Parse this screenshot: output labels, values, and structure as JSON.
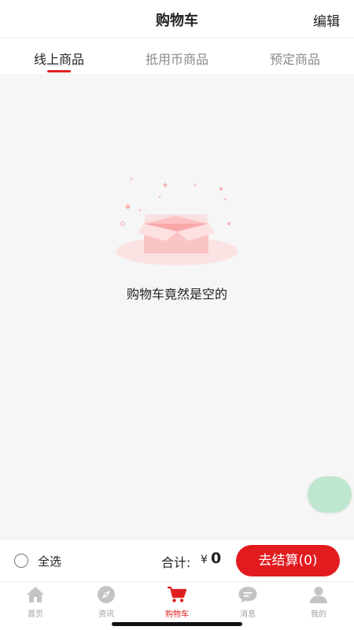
{
  "header": {
    "title": "购物车",
    "edit_label": "编辑"
  },
  "tabs": [
    {
      "label": "线上商品",
      "active": true
    },
    {
      "label": "抵用币商品",
      "active": false
    },
    {
      "label": "预定商品",
      "active": false
    }
  ],
  "empty_state": {
    "message": "购物车竟然是空的",
    "illustration": "empty-box-icon"
  },
  "checkout": {
    "select_all_label": "全选",
    "total_label": "合计:",
    "currency": "¥",
    "amount": "0",
    "pay_button_label": "去结算(0)"
  },
  "bottom_nav": [
    {
      "label": "首页",
      "icon": "home-icon",
      "active": false
    },
    {
      "label": "资讯",
      "icon": "compass-icon",
      "active": false
    },
    {
      "label": "购物车",
      "icon": "cart-icon",
      "active": true
    },
    {
      "label": "消息",
      "icon": "message-icon",
      "active": false
    },
    {
      "label": "我的",
      "icon": "profile-icon",
      "active": false
    }
  ],
  "colors": {
    "accent": "#e02020",
    "pay_button": "#e21b1f",
    "inactive_text": "#a0a0a0",
    "fab": "#bfe6cf"
  }
}
